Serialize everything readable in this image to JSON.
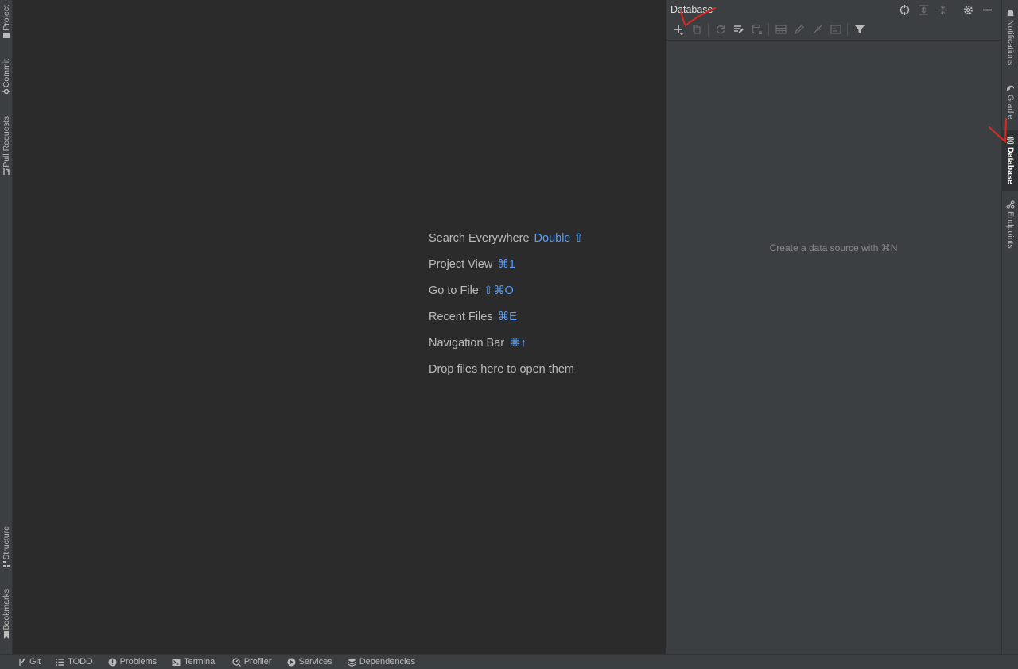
{
  "left_strip": {
    "top_tabs": [
      {
        "label": "Project",
        "icon": "folder-icon"
      },
      {
        "label": "Commit",
        "icon": "commit-icon"
      },
      {
        "label": "Pull Requests",
        "icon": "pull-request-icon"
      }
    ],
    "bottom_tabs": [
      {
        "label": "Structure",
        "icon": "structure-icon"
      },
      {
        "label": "Bookmarks",
        "icon": "bookmark-icon"
      }
    ]
  },
  "right_strip": {
    "tabs": [
      {
        "label": "Notifications",
        "icon": "bell-icon"
      },
      {
        "label": "Gradle",
        "icon": "gradle-icon"
      },
      {
        "label": "Database",
        "icon": "database-icon",
        "active": true
      },
      {
        "label": "Endpoints",
        "icon": "endpoints-icon"
      }
    ]
  },
  "editor": {
    "hints": [
      {
        "label": "Search Everywhere",
        "key": "Double ⇧"
      },
      {
        "label": "Project View",
        "key": "⌘1"
      },
      {
        "label": "Go to File",
        "key": "⇧⌘O"
      },
      {
        "label": "Recent Files",
        "key": "⌘E"
      },
      {
        "label": "Navigation Bar",
        "key": "⌘↑"
      },
      {
        "label": "Drop files here to open them",
        "key": ""
      }
    ]
  },
  "database_panel": {
    "title": "Database",
    "empty_message": "Create a data source with ⌘N",
    "header_icons": [
      "crosshair-icon",
      "expand-all-icon",
      "collapse-all-icon",
      "gear-icon",
      "minimize-icon"
    ],
    "toolbar_icons": [
      "add-icon",
      "copy-icon",
      "refresh-icon",
      "edit-schema-icon",
      "database-properties-icon",
      "table-icon",
      "edit-icon",
      "jump-icon",
      "console-icon",
      "filter-icon"
    ]
  },
  "bottom_bar": {
    "tabs": [
      {
        "label": "Git",
        "icon": "git-branch-icon"
      },
      {
        "label": "TODO",
        "icon": "list-icon"
      },
      {
        "label": "Problems",
        "icon": "problems-icon"
      },
      {
        "label": "Terminal",
        "icon": "terminal-icon"
      },
      {
        "label": "Profiler",
        "icon": "profiler-icon"
      },
      {
        "label": "Services",
        "icon": "services-icon"
      },
      {
        "label": "Dependencies",
        "icon": "dependencies-icon"
      }
    ]
  },
  "colors": {
    "background": "#2b2b2b",
    "panel": "#3c3f41",
    "accent_blue": "#589df6",
    "annotation_red": "#e0281e"
  }
}
